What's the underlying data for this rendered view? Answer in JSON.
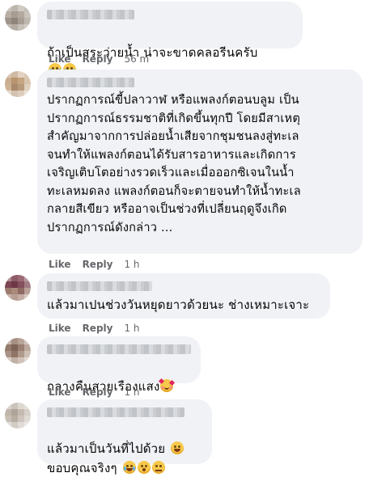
{
  "comments": [
    {
      "text": "ถ้าเป็นสระว่ายน้ำ น่าจะขาดคลอรีนครับ",
      "emojis": [
        "rolling-laughing",
        "rolling-laughing"
      ],
      "like": "Like",
      "reply": "Reply",
      "time": "56 m"
    },
    {
      "text": "ปรากฏการณ์ขี้ปลาวาฬ หรือแพลงก์ตอนบลูม เป็น\nปรากฏการณ์ธรรมชาติที่เกิดขึ้นทุกปี โดยมีสาเหตุ\nสำคัญมาจากการปล่อยน้ำเสียจากชุมชนลงสู่ทะเล\nจนทำให้แพลงก์ตอนได้รับสารอาหารและเกิดการ\nเจริญเติบโตอย่างรวดเร็วและเมื่อออกซิเจนในน้ำ\nทะเลหมดลง แพลงก์ตอนก็จะตายจนทำให้น้ำทะเล\nกลายสีเขียว หรืออาจเป็นช่วงที่เปลี่ยนฤดูจึงเกิด\nปรากฏการณ์ดังกล่าว ...",
      "like": "Like",
      "reply": "Reply",
      "time": "1 h"
    },
    {
      "text": "แล้วมาเปนช่วงวันหยุดยาวด้วยนะ ช่างเหมาะเจาะ",
      "like": "Like",
      "reply": "Reply",
      "time": "1 h"
    },
    {
      "text": "กลางคืนสวยเรืองแสง",
      "emojis": [
        "smiling-hearts"
      ],
      "like": "Like",
      "reply": "Reply",
      "time": "1 h"
    },
    {
      "line1": "แล้วมาเป็นวันที่ไปด้วย",
      "line1_emojis": [
        "grinning-smile"
      ],
      "line2": "ขอบคุณจริงๆ",
      "line2_emojis": [
        "tears-of-joy",
        "astonished",
        "flushed"
      ]
    }
  ],
  "colors": {
    "bubble": "#f0f2f5",
    "meta": "#65676b",
    "text": "#050505"
  }
}
